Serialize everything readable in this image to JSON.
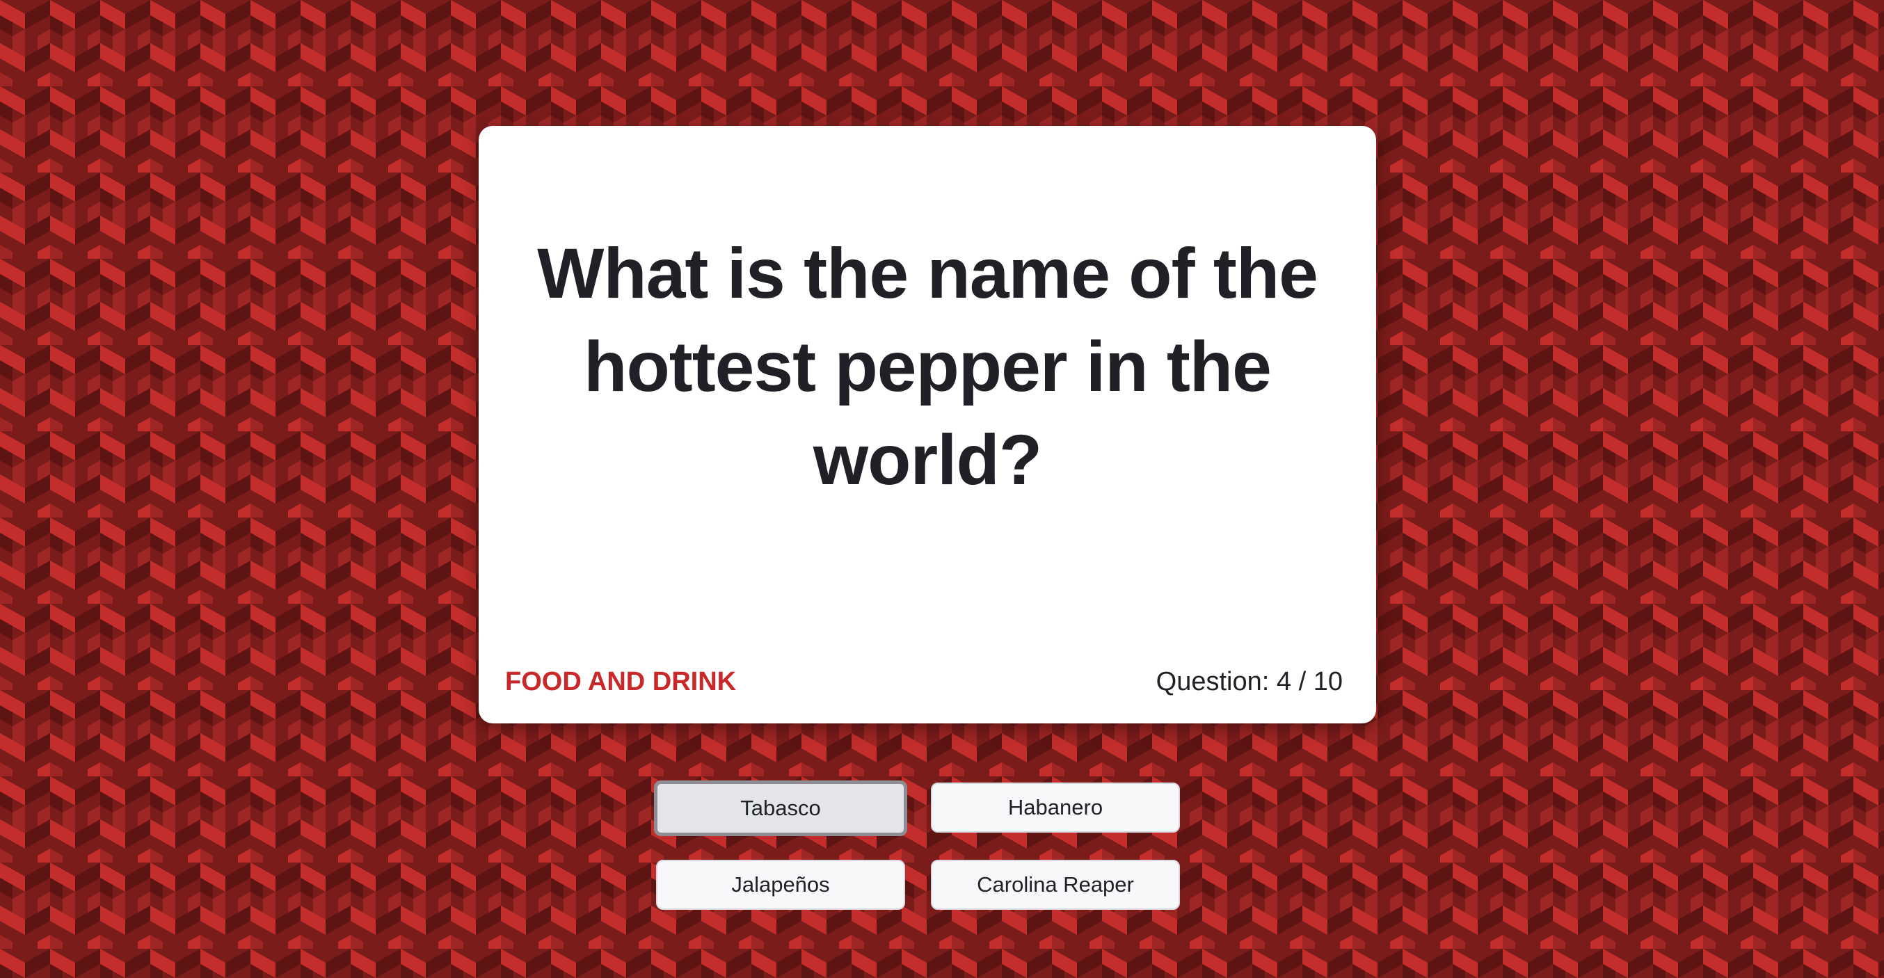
{
  "theme": {
    "background_dark": "#5e1412",
    "background_mid": "#8b2220",
    "background_light": "#c32e2c",
    "accent": "#c9282a",
    "card_background": "#ffffff",
    "text_color": "#1f2126"
  },
  "question": {
    "text": "What is the name of the hottest pepper in the world?",
    "category": "FOOD AND DRINK",
    "counter_label": "Question:",
    "current": 4,
    "total": 10,
    "separator": "/"
  },
  "answers": [
    {
      "label": "Tabasco",
      "focused": true
    },
    {
      "label": "Habanero",
      "focused": false
    },
    {
      "label": "Jalapeños",
      "focused": false
    },
    {
      "label": "Carolina Reaper",
      "focused": false
    }
  ]
}
